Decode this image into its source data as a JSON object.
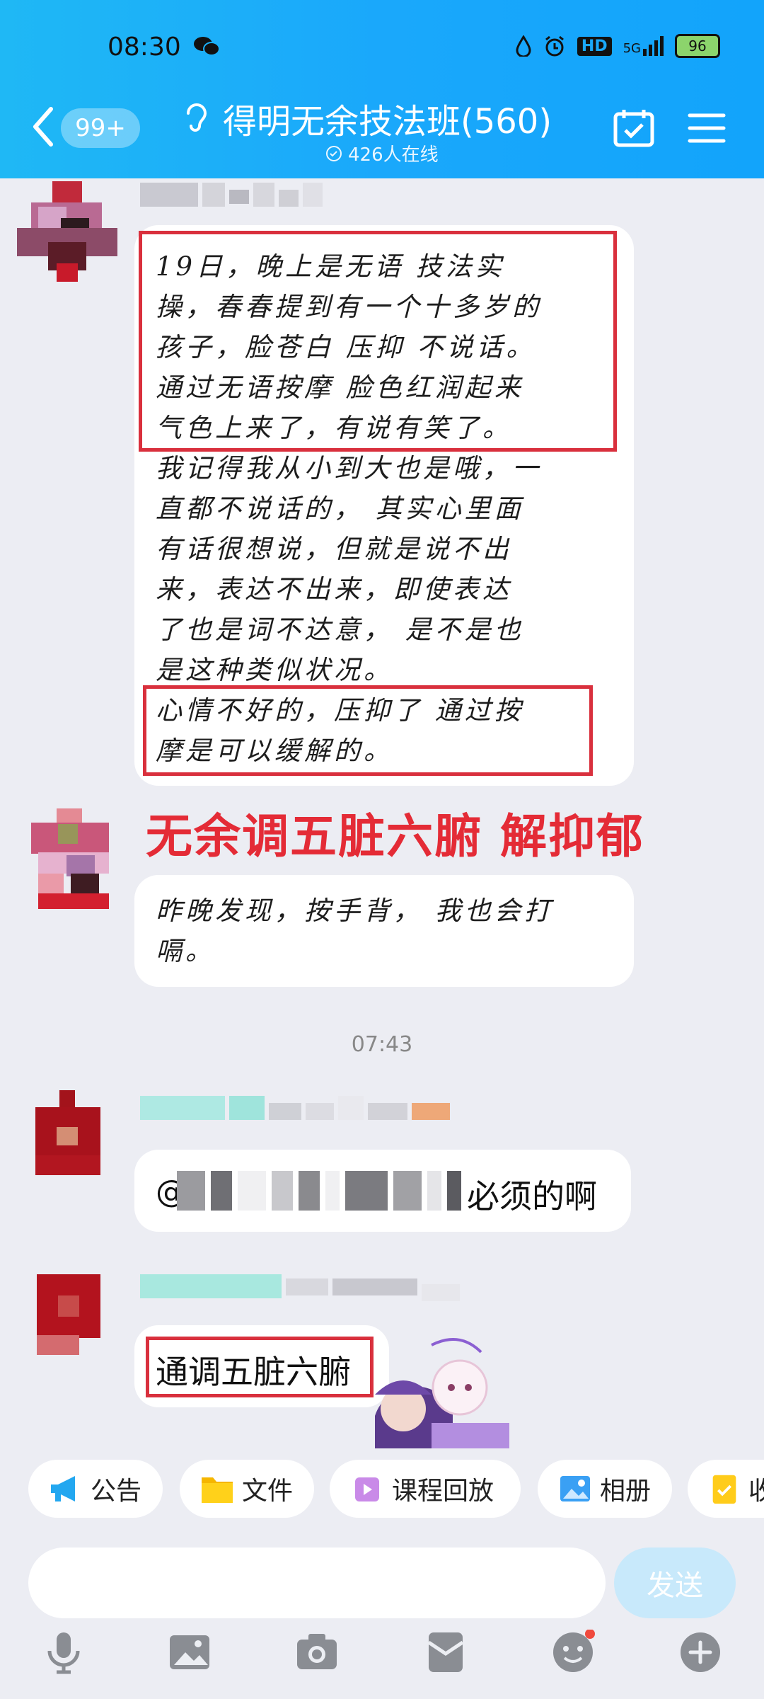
{
  "status_bar": {
    "time": "08:30",
    "network": "5G",
    "battery": "96",
    "hd": "HD"
  },
  "header": {
    "unread_badge": "99+",
    "title": "得明无余技法班(560)",
    "online": "426人在线"
  },
  "messages": [
    {
      "lines": [
        "19日，晚上是无语 技法实",
        "操，春春提到有一个十多岁的",
        "孩子，脸苍白 压抑 不说话。",
        "通过无语按摩 脸色红润起来",
        "气色上来了，有说有笑了。",
        "我记得我从小到大也是哦，一",
        "直都不说话的， 其实心里面",
        "有话很想说，但就是说不出",
        "来，表达不出来，即使表达",
        "了也是词不达意， 是不是也",
        "是这种类似状况。",
        "心情不好的，压抑了 通过按",
        "摩是可以缓解的。"
      ]
    },
    {
      "lines": [
        "昨晚发现，按手背， 我也会打",
        "嗝。"
      ]
    },
    {
      "text": "必须的啊",
      "mention": "@"
    },
    {
      "text": "通调五脏六腑"
    }
  ],
  "overlay_caption": "无余调五脏六腑 解抑郁",
  "timestamp": "07:43",
  "toolbar": {
    "items": [
      {
        "label": "公告",
        "icon": "megaphone-icon"
      },
      {
        "label": "文件",
        "icon": "folder-icon"
      },
      {
        "label": "课程回放",
        "icon": "video-icon"
      },
      {
        "label": "相册",
        "icon": "album-icon"
      },
      {
        "label": "收",
        "icon": "favorite-icon"
      }
    ]
  },
  "input": {
    "send_label": "发送"
  },
  "colors": {
    "header": "#1aa8fb",
    "highlight": "#d9303d",
    "caption": "#e42b36"
  }
}
